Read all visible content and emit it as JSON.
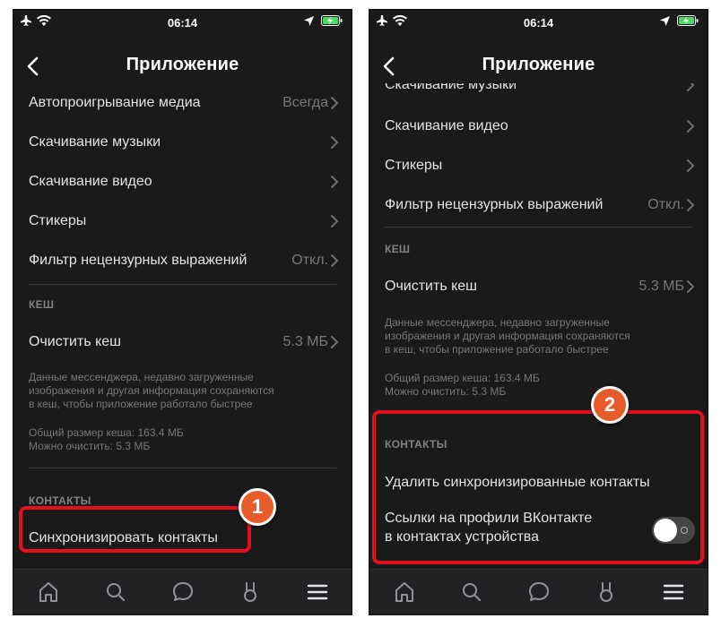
{
  "status_bar": {
    "time": "06:14"
  },
  "screen_title": "Приложение",
  "left": {
    "rows": [
      {
        "label": "Автопроигрывание медиа",
        "value": "Всегда"
      },
      {
        "label": "Скачивание музыки"
      },
      {
        "label": "Скачивание видео"
      },
      {
        "label": "Стикеры"
      },
      {
        "label": "Фильтр нецензурных выражений",
        "value": "Откл."
      }
    ],
    "cache": {
      "section_title": "КЕШ",
      "clear_label": "Очистить кеш",
      "clear_value": "5.3 МБ",
      "note1": "Данные мессенджера, недавно загруженные\nизображения и другая информация сохраняются\nв кеш, чтобы приложение работало быстрее",
      "note2": "Общий размер кеша: 163.4 МБ\nМожно очистить: 5.3 МБ"
    },
    "contacts": {
      "section_title": "КОНТАКТЫ",
      "sync_label": "Синхронизировать контакты"
    },
    "badge": "1"
  },
  "right": {
    "partial_row": "Скачивание музыки",
    "rows": [
      {
        "label": "Скачивание видео"
      },
      {
        "label": "Стикеры"
      },
      {
        "label": "Фильтр нецензурных выражений",
        "value": "Откл."
      }
    ],
    "cache": {
      "section_title": "КЕШ",
      "clear_label": "Очистить кеш",
      "clear_value": "5.3 МБ",
      "note1": "Данные мессенджера, недавно загруженные\nизображения и другая информация сохраняются\nв кеш, чтобы приложение работало быстрее",
      "note2": "Общий размер кеша: 163.4 МБ\nМожно очистить: 5.3 МБ"
    },
    "contacts": {
      "section_title": "КОНТАКТЫ",
      "delete_label": "Удалить синхронизированные контакты",
      "links_label_line1": "Ссылки на профили ВКонтакте",
      "links_label_line2": "в контактах устройства",
      "links_toggle": "off"
    },
    "badge": "2"
  },
  "tabbar": [
    "home-icon",
    "search-icon",
    "messages-icon",
    "clips-icon",
    "menu-icon"
  ],
  "colors": {
    "background": "#1a1a1b",
    "text": "#e1e3e6",
    "secondary": "#76787a",
    "callout": "#e3101b",
    "badge": "#e85b2a"
  }
}
